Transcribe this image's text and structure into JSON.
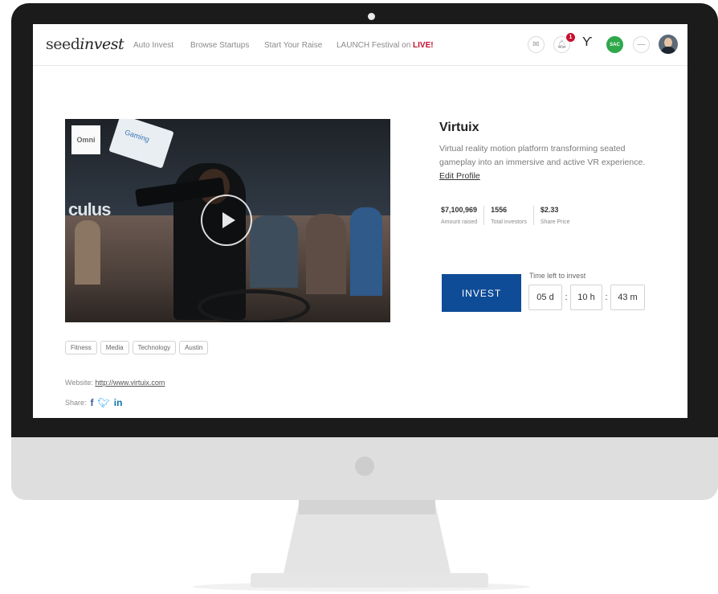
{
  "nav": {
    "logo_main": "seed",
    "logo_italic": "invest",
    "links": [
      "Auto Invest",
      "Browse Startups",
      "Start Your Raise"
    ],
    "festival_prefix": "LAUNCH Festival on ",
    "festival_live": "LIVE!",
    "notification_count": "1",
    "profile_initials": "SAC"
  },
  "company": {
    "name": "Virtuix",
    "description": "Virtual reality motion platform transforming seated gameplay into an immersive and active VR experience.",
    "edit_profile": "Edit Profile"
  },
  "stats": [
    {
      "value": "$7,100,969",
      "label": "Amount raised"
    },
    {
      "value": "1556",
      "label": "Total investors"
    },
    {
      "value": "$2.33",
      "label": "Share Price"
    }
  ],
  "invest": {
    "button": "INVEST",
    "timer_label": "Time left to invest",
    "days": "05 d",
    "hours": "10 h",
    "minutes": "43 m"
  },
  "tags": [
    "Fitness",
    "Media",
    "Technology",
    "Austin"
  ],
  "website": {
    "label": "Website: ",
    "url": "http://www.virtuix.com"
  },
  "share": {
    "label": "Share:"
  },
  "video": {
    "overlay_logo": "Omni",
    "sign_text": "Gaming",
    "banner_text": "culus"
  },
  "colors": {
    "primary_blue": "#0f4c97",
    "live_red": "#c8102e",
    "profile_green": "#2ea84a"
  }
}
